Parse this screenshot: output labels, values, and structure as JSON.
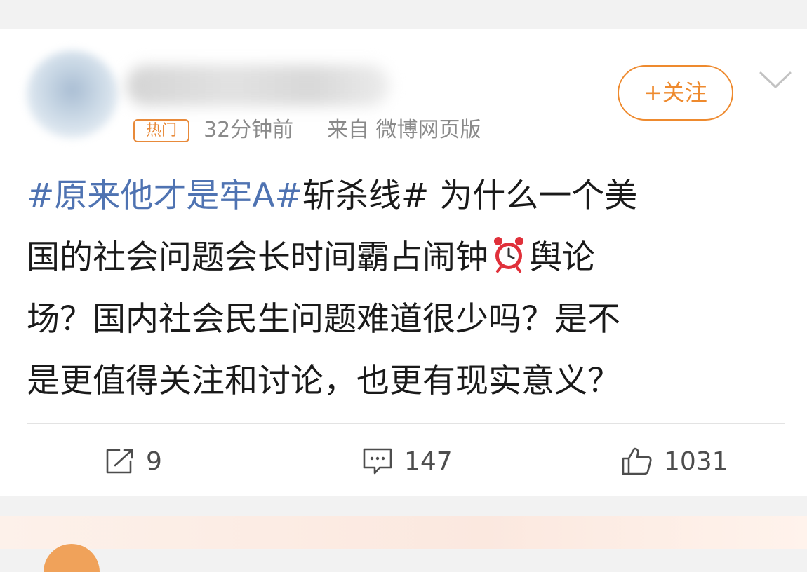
{
  "post": {
    "hot_tag": "热门",
    "time": "32分钟前",
    "source": "来自 微博网页版",
    "follow_label": "+关注",
    "content": {
      "topic1": "#原来他才是牢A#",
      "topic2": "斩杀线#",
      "line1_rest": " 为什么一个美",
      "line2_before_icon": "国的社会问题会长时间霸占闹钟",
      "line2_after_icon": "舆论",
      "line3": "场？国内社会民生问题难道很少吗？是不",
      "line4": "是更值得关注和讨论，也更有现实意义？"
    },
    "actions": {
      "repost_count": "9",
      "comment_count": "147",
      "like_count": "1031"
    }
  },
  "colors": {
    "topic_link": "#4f73b2",
    "accent_orange": "#ee8a2e",
    "alarm_red": "#e0303a"
  },
  "icons": {
    "repost": "share-icon",
    "comment": "comment-icon",
    "like": "thumbs-up-icon",
    "menu": "chevron-down-icon",
    "emoji": "alarm-clock-icon"
  }
}
